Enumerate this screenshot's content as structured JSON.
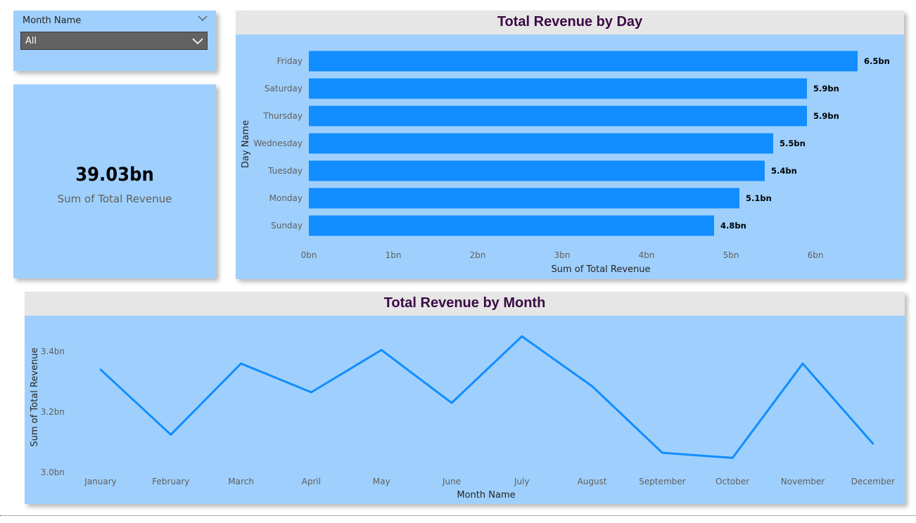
{
  "slicer": {
    "title": "Month Name",
    "value": "All"
  },
  "kpi": {
    "value": "39.03bn",
    "label": "Sum of Total Revenue"
  },
  "chart_data": [
    {
      "type": "bar",
      "orientation": "horizontal",
      "title": "Total Revenue by Day",
      "xlabel": "Sum of Total Revenue",
      "ylabel": "Day Name",
      "categories": [
        "Friday",
        "Saturday",
        "Thursday",
        "Wednesday",
        "Tuesday",
        "Monday",
        "Sunday"
      ],
      "values": [
        6.5,
        5.9,
        5.9,
        5.5,
        5.4,
        5.1,
        4.8
      ],
      "data_labels": [
        "6.5bn",
        "5.9bn",
        "5.9bn",
        "5.5bn",
        "5.4bn",
        "5.1bn",
        "4.8bn"
      ],
      "xlim": [
        0,
        6.5
      ],
      "xticks": [
        0,
        1,
        2,
        3,
        4,
        5,
        6
      ],
      "xtick_labels": [
        "0bn",
        "1bn",
        "2bn",
        "3bn",
        "4bn",
        "5bn",
        "6bn"
      ],
      "bar_color": "#118dff"
    },
    {
      "type": "line",
      "title": "Total Revenue by Month",
      "xlabel": "Month Name",
      "ylabel": "Sum of Total Revenue",
      "categories": [
        "January",
        "February",
        "March",
        "April",
        "May",
        "June",
        "July",
        "August",
        "September",
        "October",
        "November",
        "December"
      ],
      "values": [
        3.34,
        3.125,
        3.36,
        3.265,
        3.405,
        3.23,
        3.45,
        3.285,
        3.065,
        3.048,
        3.36,
        3.095
      ],
      "ylim": [
        3.0,
        3.4
      ],
      "yticks": [
        3.0,
        3.2,
        3.4
      ],
      "ytick_labels": [
        "3.0bn",
        "3.2bn",
        "3.4bn"
      ],
      "line_color": "#118dff"
    }
  ]
}
